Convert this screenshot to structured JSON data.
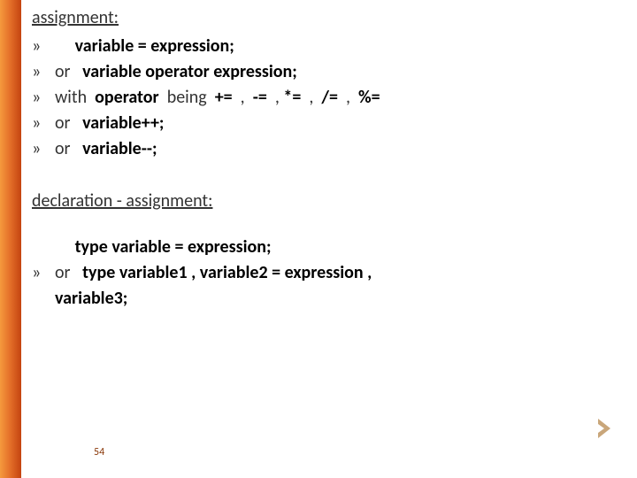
{
  "section1": {
    "title": "assignment:"
  },
  "lines1": [
    {
      "mark": "»",
      "prefix": "",
      "bold": "variable = expression;"
    },
    {
      "mark": "»",
      "prefix": "or   ",
      "bold": "variable operator expression;"
    },
    {
      "mark": "»",
      "prefix": "with  ",
      "bold": "operator",
      "suffix": "  being  ",
      "bold2": "+=",
      "s2": "  ,  ",
      "bold3": "-=",
      "s3": "  , ",
      "bold4": "*=",
      "s4": "  ,  ",
      "bold5": "/=",
      "s5": "  ,  ",
      "bold6": "%="
    },
    {
      "mark": "»",
      "prefix": "or   ",
      "bold": "variable++;"
    },
    {
      "mark": "»",
      "prefix": "or   ",
      "bold": "variable--;"
    }
  ],
  "section2": {
    "title": "declaration - assignment:"
  },
  "lines2": {
    "lead": "type variable = expression;",
    "mark": "»",
    "prefix": "or   ",
    "bold1": "type variable1 , variable2 = expression ,",
    "bold2": "variable3;"
  },
  "page": "54"
}
